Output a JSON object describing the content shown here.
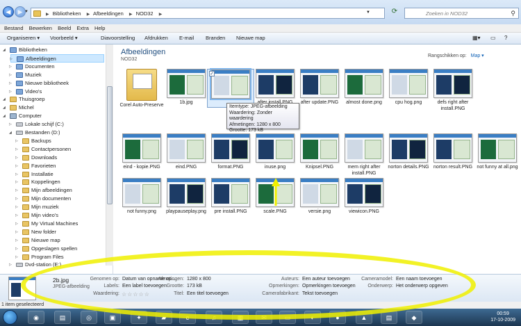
{
  "address": {
    "crumbs": [
      "Bibliotheken",
      "Afbeeldingen",
      "NOD32"
    ],
    "search_placeholder": "Zoeken in NOD32"
  },
  "menu": [
    "Bestand",
    "Bewerken",
    "Beeld",
    "Extra",
    "Help"
  ],
  "toolbar": [
    "Organiseren ▾",
    "Voorbeeld ▾",
    "Diavoorstelling",
    "Afdrukken",
    "E-mail",
    "Branden",
    "Nieuwe map"
  ],
  "tree": [
    {
      "label": "Bibliotheken",
      "level": 1,
      "icon": "library"
    },
    {
      "label": "Afbeeldingen",
      "level": 2,
      "icon": "library",
      "selected": true
    },
    {
      "label": "Documenten",
      "level": 2,
      "icon": "library"
    },
    {
      "label": "Muziek",
      "level": 2,
      "icon": "library"
    },
    {
      "label": "Nieuwe bibliotheek",
      "level": 2,
      "icon": "library"
    },
    {
      "label": "Video's",
      "level": 2,
      "icon": "library"
    },
    {
      "label": "Thuisgroep",
      "level": 1,
      "icon": "homegroup"
    },
    {
      "label": "Michel",
      "level": 1,
      "icon": "user"
    },
    {
      "label": "Computer",
      "level": 1,
      "icon": "computer"
    },
    {
      "label": "Lokale schijf (C:)",
      "level": 2,
      "icon": "drive"
    },
    {
      "label": "Bestanden (D:)",
      "level": 2,
      "icon": "drive"
    },
    {
      "label": "Backups",
      "level": 3,
      "icon": "folder"
    },
    {
      "label": "Contactpersonen",
      "level": 3,
      "icon": "folder"
    },
    {
      "label": "Downloads",
      "level": 3,
      "icon": "folder"
    },
    {
      "label": "Favorieten",
      "level": 3,
      "icon": "folder"
    },
    {
      "label": "Installatie",
      "level": 3,
      "icon": "folder"
    },
    {
      "label": "Koppelingen",
      "level": 3,
      "icon": "folder"
    },
    {
      "label": "Mijn afbeeldingen",
      "level": 3,
      "icon": "folder"
    },
    {
      "label": "Mijn documenten",
      "level": 3,
      "icon": "folder"
    },
    {
      "label": "Mijn muziek",
      "level": 3,
      "icon": "folder"
    },
    {
      "label": "Mijn video's",
      "level": 3,
      "icon": "folder"
    },
    {
      "label": "My Virtual Machines",
      "level": 3,
      "icon": "folder"
    },
    {
      "label": "New folder",
      "level": 3,
      "icon": "folder"
    },
    {
      "label": "Nieuwe map",
      "level": 3,
      "icon": "folder"
    },
    {
      "label": "Opgeslagen spellen",
      "level": 3,
      "icon": "folder"
    },
    {
      "label": "Program Files",
      "level": 3,
      "icon": "folder"
    },
    {
      "label": "Dvd-station (E:)",
      "level": 2,
      "icon": "drive"
    }
  ],
  "library": {
    "title": "Afbeeldingen",
    "subtitle": "NOD32",
    "arrange_label": "Rangschikken op:",
    "arrange_value": "Map ▾"
  },
  "files": [
    [
      "Corel Auto-Preserve",
      "2b.jpg",
      "",
      "after install.PNG",
      "after update.PNG",
      "almost done.png",
      "cpu hog.png",
      "defs right after install.PNG"
    ],
    [
      "eind - kopie.PNG",
      "eind.PNG",
      "format.PNG",
      "inuse.png",
      "Knipsel.PNG",
      "mem right after install.PNG",
      "norton details.PNG",
      "norton result.PNG",
      "not funny at all.png"
    ],
    [
      "not funny.png",
      "playpauseplay.png",
      "pre install.PNG",
      "scale.PNG",
      "versie.png",
      "viewicon.PNG"
    ]
  ],
  "first_row_second": "1b.jpg",
  "tooltip": [
    "Itemtype: JPEG-afbeelding",
    "Waardering: Zonder waardering",
    "Afmetingen: 1280 x 800",
    "Grootte: 173 kB"
  ],
  "details": {
    "name": "2b.jpg",
    "type": "JPEG-afbeelding",
    "fields": [
      {
        "label": "Genomen op:",
        "value": "Datum van opname op..."
      },
      {
        "label": "Labels:",
        "value": "Een label toevoegen"
      },
      {
        "label": "Waardering:",
        "value": "☆☆☆☆☆"
      },
      {
        "label": "Afmetingen:",
        "value": "1280 x 800"
      },
      {
        "label": "Grootte:",
        "value": "173 kB"
      },
      {
        "label": "Titel:",
        "value": "Een titel toevoegen"
      },
      {
        "label": "Auteurs:",
        "value": "Een auteur toevoegen"
      },
      {
        "label": "Opmerkingen:",
        "value": "Opmerkingen toevoegen"
      },
      {
        "label": "Camerafabrikant:",
        "value": "Tekst toevoegen"
      },
      {
        "label": "Cameramodel:",
        "value": "Een naam toevoegen"
      },
      {
        "label": "Onderwerp:",
        "value": "Het onderwerp opgeven"
      }
    ]
  },
  "status": "1 item geselecteerd",
  "clock": {
    "time": "00:59",
    "date": "17-10-2009"
  },
  "colors": {
    "highlight": "#f0f000",
    "accent": "#1f4d7f"
  }
}
